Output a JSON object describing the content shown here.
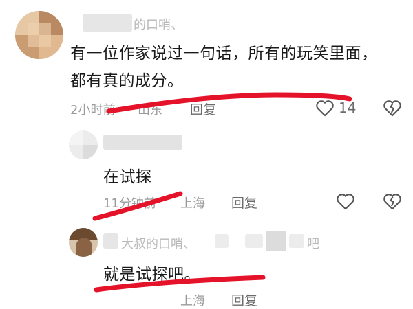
{
  "comments": [
    {
      "author": "的口哨、",
      "text_line1": "有一位作家说过一句话，所有的玩笑里面，",
      "text_line2": "都有真的成分。",
      "time": "2小时前",
      "location": "山东",
      "reply_label": "回复",
      "like_count": "14"
    },
    {
      "author": "",
      "text": "在试探",
      "time": "11分钟前",
      "location": "上海",
      "reply_label": "回复"
    },
    {
      "author": "大叔的口哨、",
      "author_suffix": "吧",
      "text": "就是试探吧。",
      "time": "",
      "location": "上海",
      "reply_label": "回复"
    }
  ],
  "colors": {
    "annotation_red": "#e5132a",
    "meta_gray": "#9a9a9a",
    "text_black": "#1a1a1a"
  },
  "icons": {
    "like": "heart-outline-icon",
    "dislike": "broken-heart-icon",
    "annotation": "red-underline"
  }
}
